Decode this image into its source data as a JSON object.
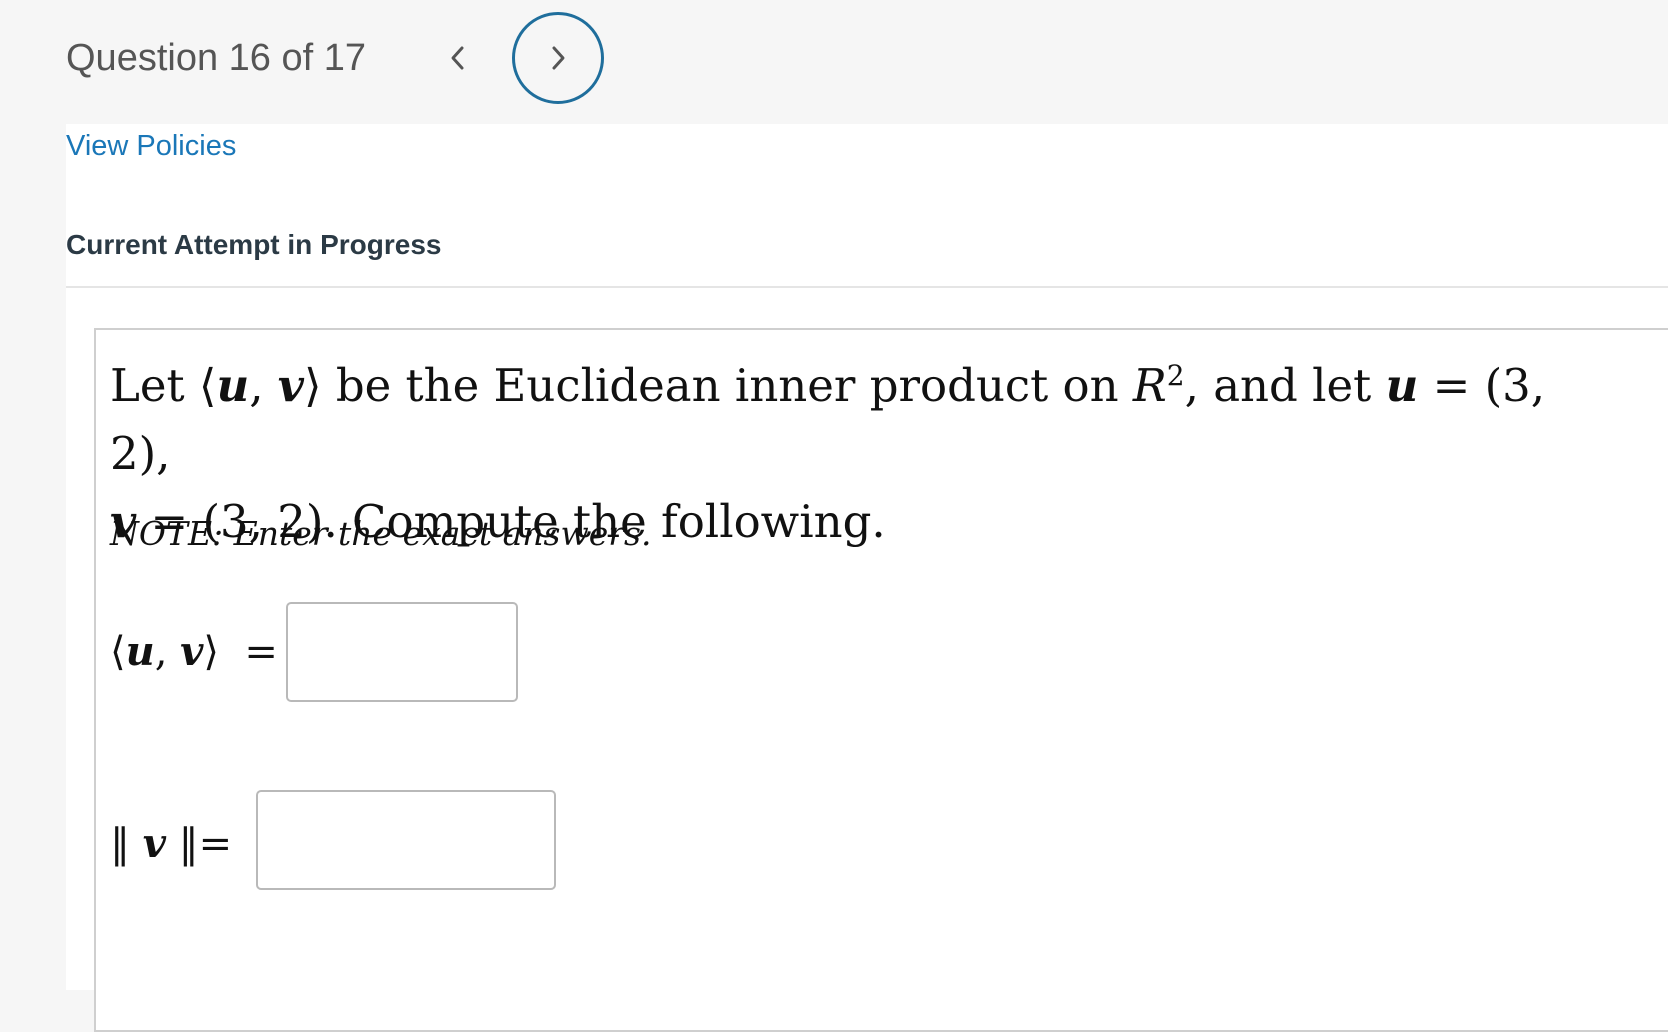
{
  "header": {
    "question_counter": "Question 16 of 17",
    "prev_icon": "chevron-left-icon",
    "next_icon": "chevron-right-icon",
    "accent_color": "#1f6e9c"
  },
  "links": {
    "view_policies": "View Policies"
  },
  "status": {
    "attempt": "Current Attempt in Progress"
  },
  "question": {
    "stem_line1_a": "Let ⟨",
    "u": "u",
    "comma_sep": ", ",
    "v": "v",
    "stem_line1_b": "⟩ be the Euclidean inner product on ",
    "space": "R",
    "space_exp": "2",
    "stem_line1_c": ", and let ",
    "u_value": " = (3, 2),",
    "v_value": " = (3, 2). Compute the following.",
    "note": "NOTE: Enter the exact answers.",
    "answer1_label_open": "⟨",
    "answer1_label_close": "⟩  =",
    "answer2_label_open": "‖ ",
    "answer2_label_close": " ‖=",
    "answer1_value": "",
    "answer2_value": ""
  }
}
